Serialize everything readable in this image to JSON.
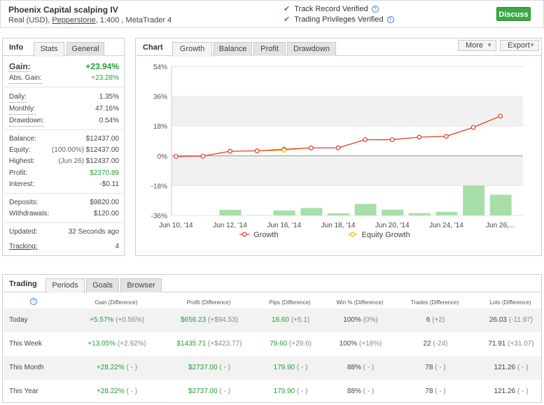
{
  "header": {
    "account_name": "Phoenix Capital scalping IV",
    "meta_prefix": "Real (USD), ",
    "broker": "Pepperstone",
    "meta_suffix": ", 1:400 , MetaTrader 4",
    "verify_track": "Track Record Verified",
    "verify_privileges": "Trading Privileges Verified",
    "discuss_label": "Discuss"
  },
  "info": {
    "title": "Info",
    "tabs": [
      "Stats",
      "General"
    ],
    "gain_label": "Gain:",
    "gain_value": "+23.94%",
    "abs_gain_label": "Abs. Gain:",
    "abs_gain_value": "+23.28%",
    "daily_label": "Daily:",
    "daily_value": "1.35%",
    "monthly_label": "Monthly:",
    "monthly_value": "47.16%",
    "drawdown_label": "Drawdown:",
    "drawdown_value": "0.54%",
    "balance_label": "Balance:",
    "balance_value": "$12437.00",
    "equity_label": "Equity:",
    "equity_note": "(100.00%)",
    "equity_value": "$12437.00",
    "highest_label": "Highest:",
    "highest_note": "(Jun 26)",
    "highest_value": "$12437.00",
    "profit_label": "Profit:",
    "profit_value": "$2370.89",
    "interest_label": "Interest:",
    "interest_value": "-$0.11",
    "deposits_label": "Deposits:",
    "deposits_value": "$9820.00",
    "withdrawals_label": "Withdrawals:",
    "withdrawals_value": "$120.00",
    "updated_label": "Updated:",
    "updated_value": "32 Seconds ago",
    "tracking_label": "Tracking:",
    "tracking_value": "4"
  },
  "chart_panel": {
    "title": "Chart",
    "tabs": [
      "Growth",
      "Balance",
      "Profit",
      "Drawdown"
    ],
    "more_label": "More",
    "export_label": "Export"
  },
  "chart_data": {
    "type": "line",
    "x_tick_labels": [
      "Jun 10, '14",
      "Jun 12, '14",
      "Jun 16, '14",
      "Jun 18, '14",
      "Jun 20, '14",
      "Jun 24, '14",
      "Jun 26,..."
    ],
    "y_tick_labels": [
      "54%",
      "36%",
      "18%",
      "0%",
      "-18%",
      "-36%"
    ],
    "ylim": [
      -36,
      54
    ],
    "series": [
      {
        "name": "Growth",
        "color": "#e0392b",
        "values": [
          -0.3,
          -0.2,
          2.8,
          3.0,
          4.0,
          4.8,
          4.8,
          9.8,
          9.8,
          11.3,
          11.8,
          17.2,
          24.0
        ]
      },
      {
        "name": "Equity Growth",
        "color": "#f0b400",
        "values": [
          -0.3,
          -0.2,
          2.8,
          3.0,
          3.4,
          4.8,
          4.8,
          9.8,
          9.8,
          11.3,
          11.8,
          17.2,
          24.0
        ]
      }
    ],
    "bars": {
      "color": "#a8deaa",
      "values": [
        0,
        0,
        3.4,
        0.2,
        3.0,
        4.5,
        1.3,
        7.0,
        3.5,
        1.4,
        2.2,
        18.1,
        12.5
      ],
      "baseline": -36
    }
  },
  "trading": {
    "title": "Trading",
    "tabs": [
      "Periods",
      "Goals",
      "Browser"
    ],
    "columns": [
      "Gain (Difference)",
      "Profit (Difference)",
      "Pips (Difference)",
      "Win % (Difference)",
      "Trades (Difference)",
      "Lots (Difference)"
    ],
    "rows": [
      {
        "period": "Today",
        "gain": "+5.57%",
        "gain_diff": "(+0.56%)",
        "profit": "$656.23",
        "profit_diff": "(+$94.53)",
        "pips": "18.60",
        "pips_diff": "(+5.1)",
        "win": "100%",
        "win_diff": "(0%)",
        "trades": "6",
        "trades_diff": "(+2)",
        "lots": "26.03",
        "lots_diff": "(-11.97)"
      },
      {
        "period": "This Week",
        "gain": "+13.05%",
        "gain_diff": "(+2.92%)",
        "profit": "$1435.71",
        "profit_diff": "(+$423.77)",
        "pips": "79.60",
        "pips_diff": "(+29.6)",
        "win": "100%",
        "win_diff": "(+18%)",
        "trades": "22",
        "trades_diff": "(-24)",
        "lots": "71.91",
        "lots_diff": "(+31.07)"
      },
      {
        "period": "This Month",
        "gain": "+28.22%",
        "gain_diff": "( - )",
        "profit": "$2737.00",
        "profit_diff": "( - )",
        "pips": "179.90",
        "pips_diff": "( - )",
        "win": "88%",
        "win_diff": "( - )",
        "trades": "78",
        "trades_diff": "( - )",
        "lots": "121.26",
        "lots_diff": "( - )"
      },
      {
        "period": "This Year",
        "gain": "+28.22%",
        "gain_diff": "( - )",
        "profit": "$2737.00",
        "profit_diff": "( - )",
        "pips": "179.90",
        "pips_diff": "( - )",
        "win": "88%",
        "win_diff": "( - )",
        "trades": "78",
        "trades_diff": "( - )",
        "lots": "121.26",
        "lots_diff": "( - )"
      }
    ]
  }
}
